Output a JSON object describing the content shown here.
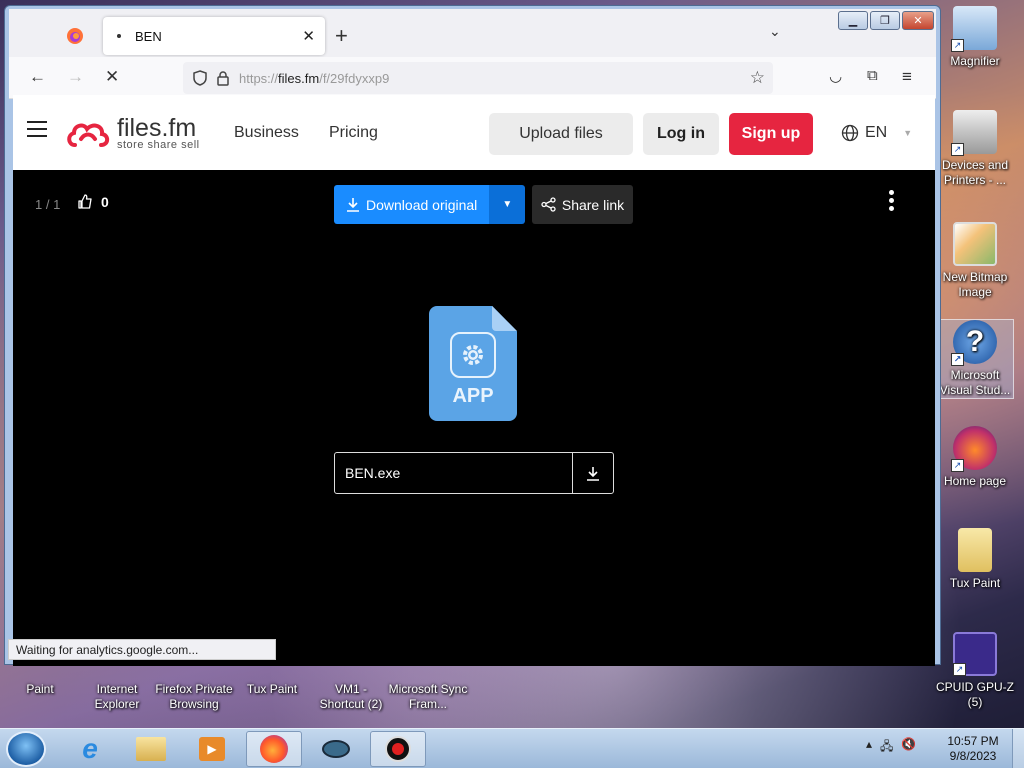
{
  "browser": {
    "tab_title": "BEN",
    "url_prefix": "https://",
    "url_host": "files.fm",
    "url_path": "/f/29fdyxxp9",
    "status": "Waiting for analytics.google.com..."
  },
  "site": {
    "logo_main": "files.fm",
    "logo_sub": "store share sell",
    "nav_business": "Business",
    "nav_pricing": "Pricing",
    "upload": "Upload files",
    "login": "Log in",
    "signup": "Sign up",
    "lang": "EN",
    "accent": "#e62540"
  },
  "viewer": {
    "counter": "1 / 1",
    "likes": "0",
    "download": "Download original",
    "share": "Share link",
    "file_type": "APP",
    "filename": "BEN.exe",
    "accent": "#1a8cff"
  },
  "desktop": {
    "right_icons": [
      "Magnifier",
      "Devices and Printers - ...",
      "New Bitmap Image",
      "Microsoft Visual Stud...",
      "Home page",
      "Tux Paint",
      "CPUID GPU-Z (5)"
    ],
    "bottom_icons": [
      "Paint",
      "Internet Explorer",
      "Firefox Private Browsing",
      "Tux Paint",
      "VM1 - Shortcut (2)",
      "Microsoft Sync Fram..."
    ]
  },
  "taskbar": {
    "time": "10:57 PM",
    "date": "9/8/2023"
  }
}
